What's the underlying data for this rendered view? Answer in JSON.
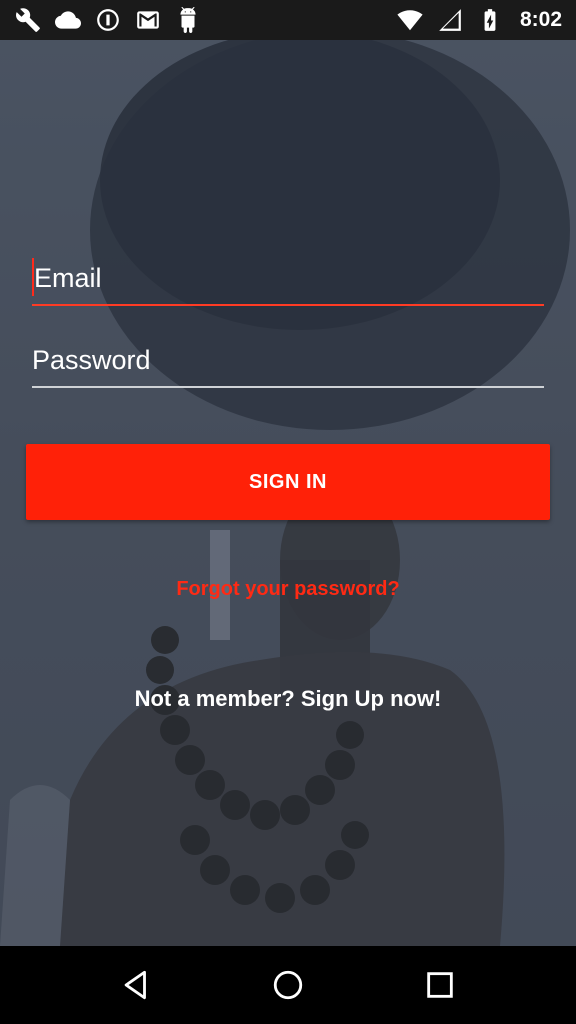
{
  "status_bar": {
    "time": "8:02",
    "left_icons": [
      "wrench-icon",
      "cloud-icon",
      "info-circle-icon",
      "gmail-icon",
      "android-icon"
    ],
    "right_icons": [
      "wifi-icon",
      "cell-signal-icon",
      "battery-charging-icon"
    ]
  },
  "login": {
    "email_placeholder": "Email",
    "password_placeholder": "Password",
    "sign_in_label": "SIGN IN",
    "forgot_password_label": "Forgot your password?",
    "sign_up_label": "Not a member? Sign Up now!"
  },
  "nav_bar": {
    "buttons": [
      "back-icon",
      "home-icon",
      "recents-icon"
    ]
  },
  "colors": {
    "accent": "#ff2108",
    "link": "#ff2a14",
    "background": "#444c59"
  }
}
